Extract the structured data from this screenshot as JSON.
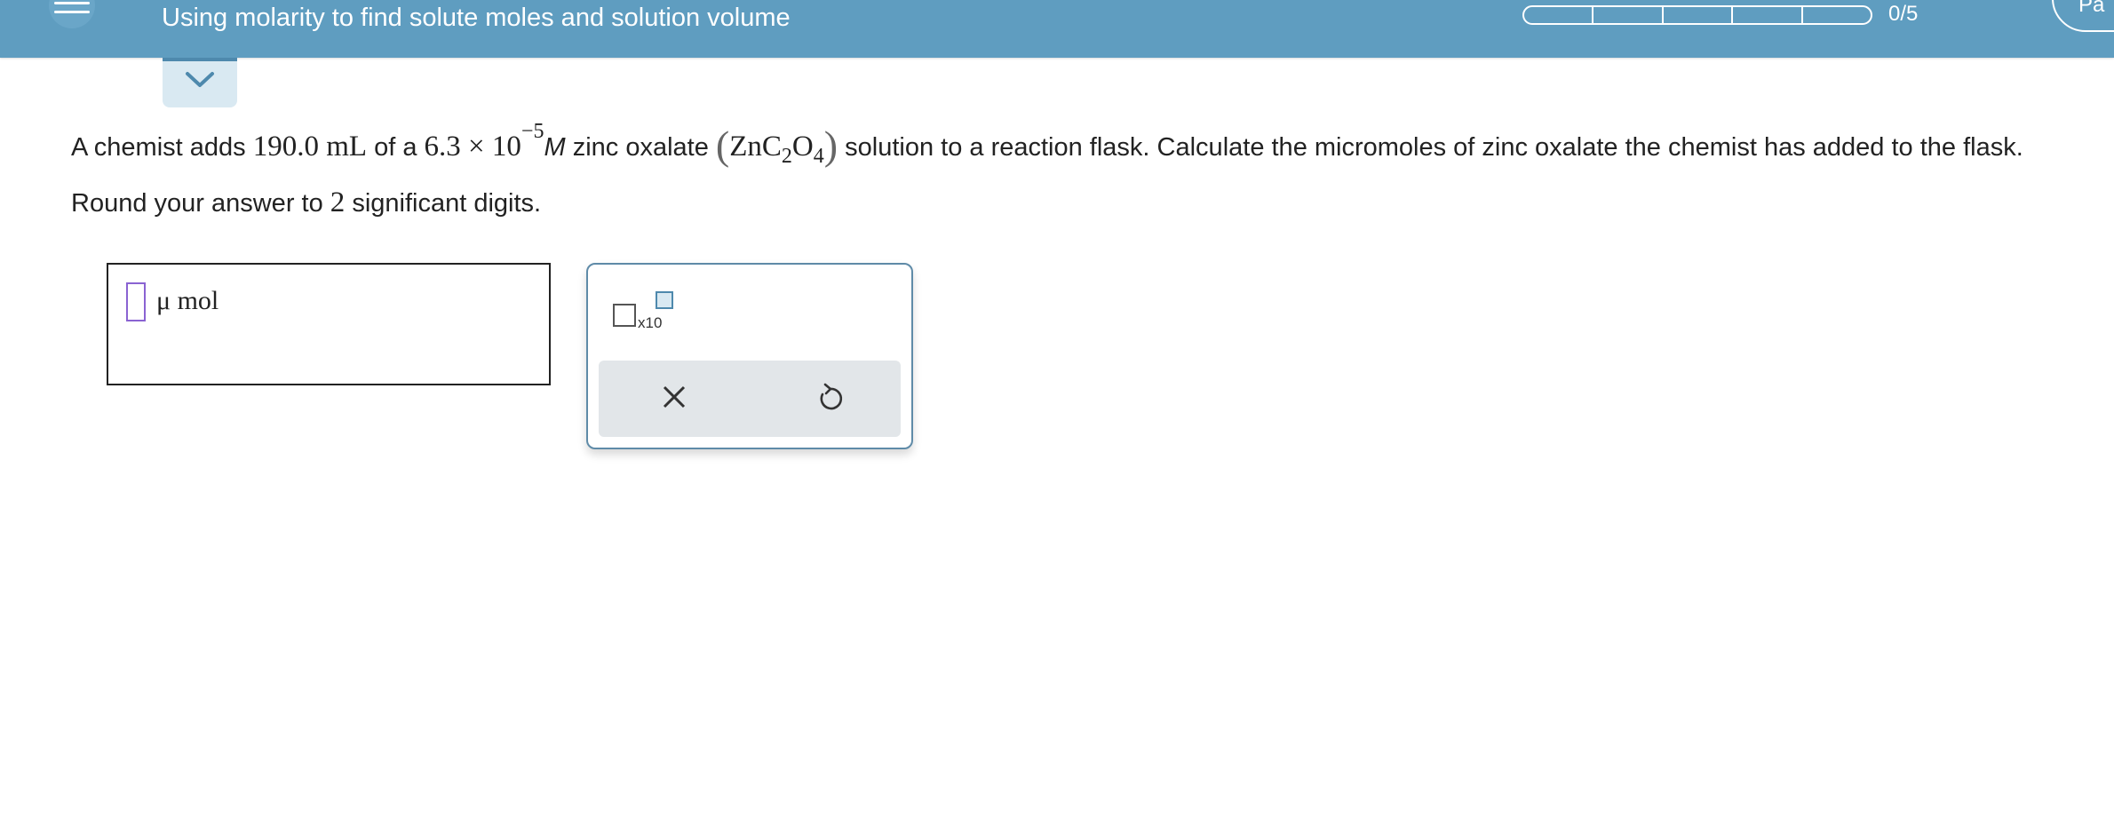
{
  "header": {
    "title": "Using molarity to find solute moles and solution volume",
    "progress_text": "0/5",
    "progress_segments": 5,
    "progress_completed": 0,
    "part_label": "Pa"
  },
  "question": {
    "t1": "A chemist adds ",
    "volume": "190.0 mL",
    "t2": " of a ",
    "coef": "6.3 × 10",
    "exp": "−5",
    "molar": "M",
    "t3": " zinc oxalate ",
    "f_zn": "ZnC",
    "f_s1": "2",
    "f_o": "O",
    "f_s2": "4",
    "t4": " solution to a reaction flask. Calculate the micromoles of zinc oxalate the chemist has added to the flask. Round your answer to ",
    "digits": "2",
    "t5": " significant digits."
  },
  "answer": {
    "value": "",
    "unit": "μ mol"
  },
  "palette": {
    "sci_label": "x10"
  },
  "colors": {
    "header_bg": "#5f9dc0",
    "cursor": "#8a63d2"
  }
}
